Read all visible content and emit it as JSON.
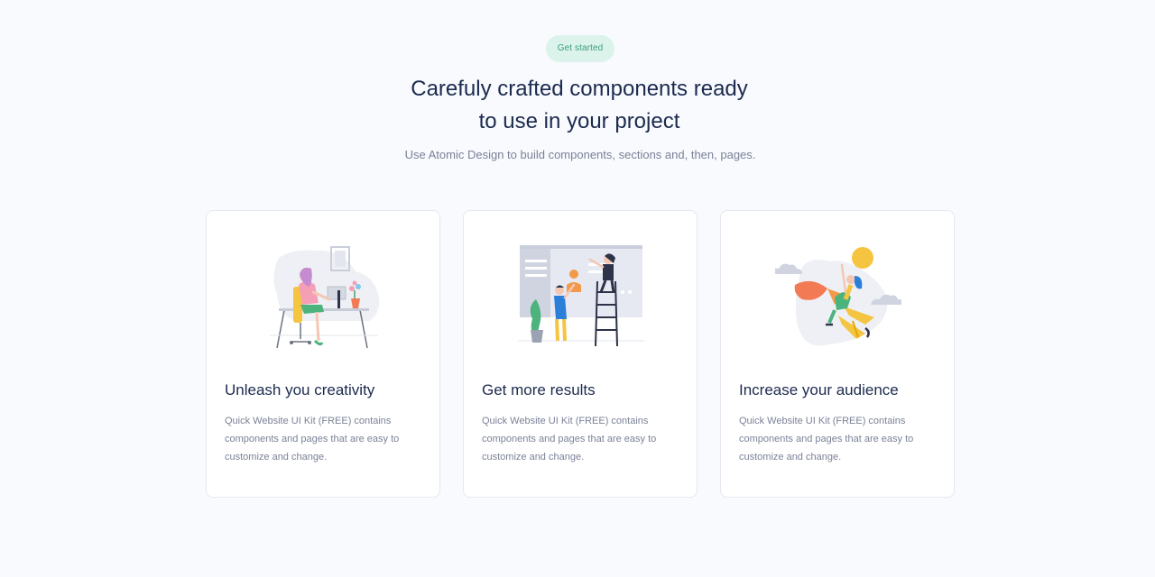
{
  "header": {
    "badge": "Get started",
    "title_line1": "Carefuly crafted components ready",
    "title_line2": "to use in your project",
    "subtitle": "Use Atomic Design to build components, sections and, then, pages."
  },
  "cards": [
    {
      "title": "Unleash you creativity",
      "text": "Quick Website UI Kit (FREE) contains components and pages that are easy to customize and change.",
      "illustration": "woman-at-desk-illustration"
    },
    {
      "title": "Get more results",
      "text": "Quick Website UI Kit (FREE) contains components and pages that are easy to customize and change.",
      "illustration": "team-at-whiteboard-illustration"
    },
    {
      "title": "Increase your audience",
      "text": "Quick Website UI Kit (FREE) contains components and pages that are easy to customize and change.",
      "illustration": "person-on-rocket-illustration"
    }
  ],
  "colors": {
    "background": "#f8fafe",
    "heading": "#1b2a4e",
    "muted": "#7b8297",
    "badge_bg": "#dcf3ec",
    "badge_text": "#3d9f80",
    "card_border": "#e5e8ef"
  }
}
